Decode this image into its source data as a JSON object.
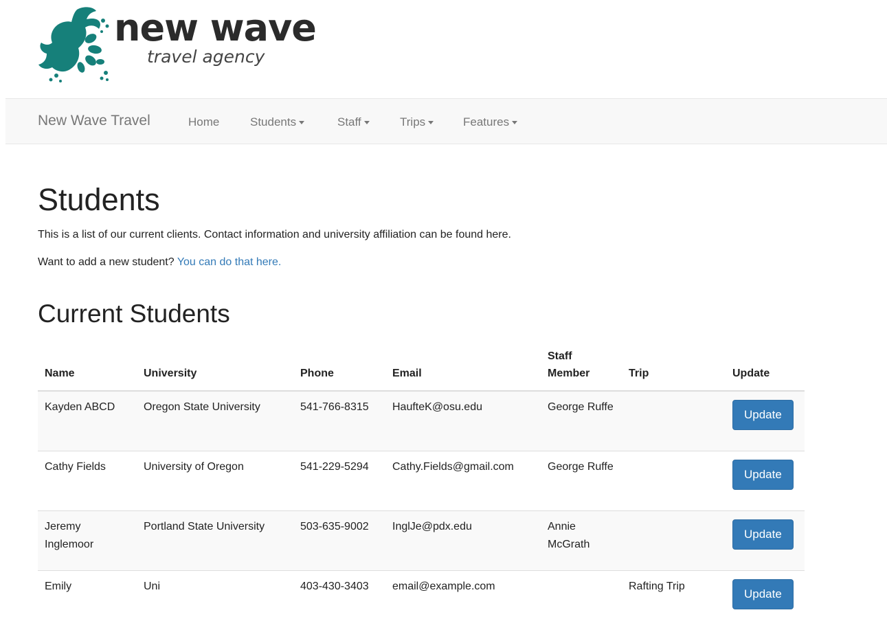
{
  "logo": {
    "title": "new wave",
    "subtitle": "travel agency",
    "brand_color": "#16807a"
  },
  "navbar": {
    "brand": "New Wave Travel",
    "items": [
      {
        "label": "Home",
        "dropdown": false
      },
      {
        "label": "Students",
        "dropdown": true
      },
      {
        "label": "Staff",
        "dropdown": true
      },
      {
        "label": "Trips",
        "dropdown": true
      },
      {
        "label": "Features",
        "dropdown": true
      }
    ]
  },
  "page": {
    "title": "Students",
    "intro": "This is a list of our current clients. Contact information and university affiliation can be found here.",
    "add_prompt": "Want to add a new student?",
    "add_link": "You can do that here.",
    "section_title": "Current Students"
  },
  "table": {
    "headers": [
      "Name",
      "University",
      "Phone",
      "Email",
      "Staff Member",
      "Trip",
      "Update"
    ],
    "rows": [
      {
        "name": "Kayden ABCD",
        "university": "Oregon State University",
        "phone": "541-766-8315",
        "email": "HaufteK@osu.edu",
        "staff": "George Ruffe",
        "trip": "",
        "button": "Update"
      },
      {
        "name": "Cathy Fields",
        "university": "University of Oregon",
        "phone": "541-229-5294",
        "email": "Cathy.Fields@gmail.com",
        "staff": "George Ruffe",
        "trip": "",
        "button": "Update"
      },
      {
        "name": "Jeremy Inglemoor",
        "university": "Portland State University",
        "phone": "503-635-9002",
        "email": "InglJe@pdx.edu",
        "staff": "Annie McGrath",
        "trip": "",
        "button": "Update"
      },
      {
        "name": "Emily",
        "university": "Uni",
        "phone": "403-430-3403",
        "email": "email@example.com",
        "staff": "",
        "trip": "Rafting Trip",
        "button": "Update"
      }
    ]
  },
  "colors": {
    "link": "#337ab7",
    "button": "#337ab7",
    "navbar_bg": "#f8f8f8"
  }
}
